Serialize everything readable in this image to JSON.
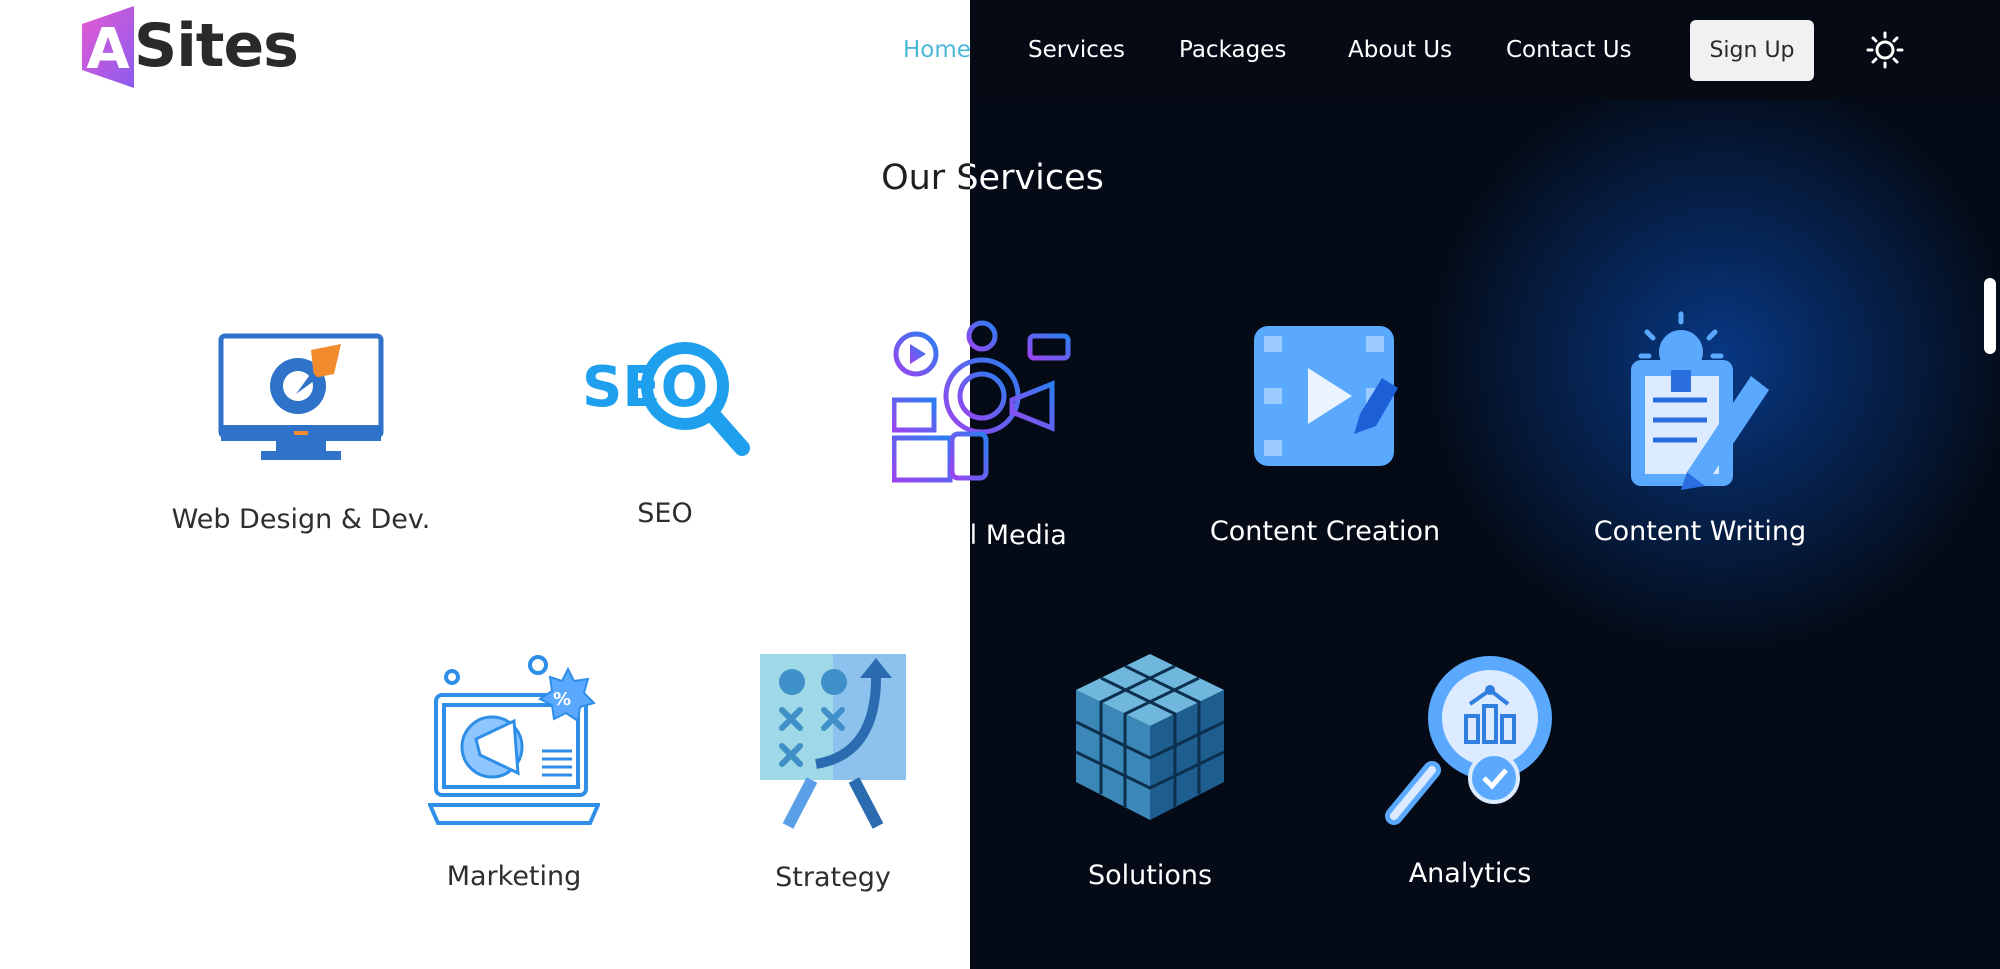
{
  "brand": {
    "logo_letter": "A",
    "name": "Sites"
  },
  "nav": {
    "items": [
      {
        "label": "Home",
        "active": true
      },
      {
        "label": "Services"
      },
      {
        "label": "Packages"
      },
      {
        "label": "About Us"
      },
      {
        "label": "Contact Us"
      }
    ],
    "signup_label": "Sign Up",
    "theme_toggle_icon": "sun-icon"
  },
  "services": {
    "title": "Our Services",
    "items": [
      {
        "label": "Web Design & Dev.",
        "icon": "monitor-gear-icon"
      },
      {
        "label": "SEO",
        "icon": "seo-magnifier-icon"
      },
      {
        "label": "Social Media",
        "icon": "social-media-icon"
      },
      {
        "label": "Content Creation",
        "icon": "video-pencil-icon"
      },
      {
        "label": "Content Writing",
        "icon": "notepad-bulb-icon"
      },
      {
        "label": "Marketing",
        "icon": "laptop-megaphone-icon"
      },
      {
        "label": "Strategy",
        "icon": "strategy-board-icon"
      },
      {
        "label": "Solutions",
        "icon": "cube-icon"
      },
      {
        "label": "Analytics",
        "icon": "magnifier-chart-icon"
      }
    ]
  },
  "colors": {
    "accent": "#4bb8d8",
    "icon_blue": "#2f7fe0",
    "dark_bg": "#040b17",
    "light_bg": "#ffffff"
  }
}
